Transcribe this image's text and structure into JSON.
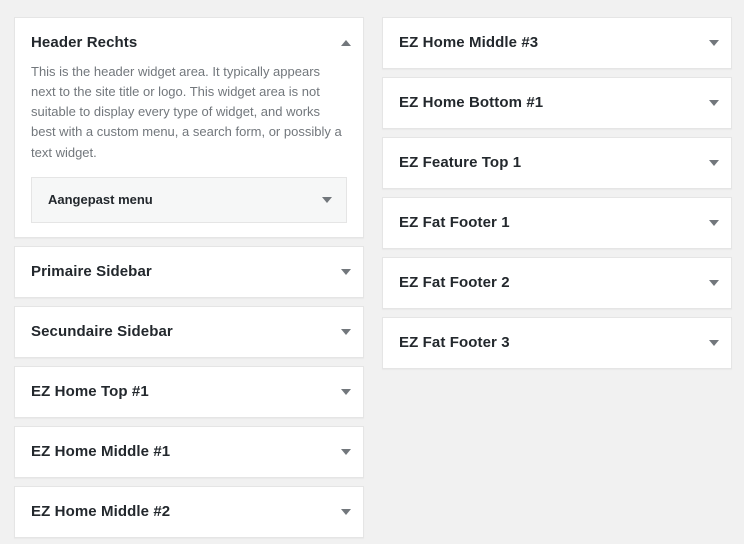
{
  "colors": {
    "page_background": "#f1f1f1",
    "panel_background": "#ffffff",
    "panel_border": "#e5e5e5",
    "title_text": "#23282d",
    "description_text": "#72777c",
    "widget_item_background": "#f6f7f7",
    "toggle_arrow": "#72777c"
  },
  "icons": {
    "collapsed": "chevron-down-icon",
    "expanded": "chevron-up-icon"
  },
  "columns": {
    "left": {
      "widget_areas": [
        {
          "title": "Header Rechts",
          "expanded": true,
          "toggle_icon": "chevron-up-icon",
          "description": "This is the header widget area. It typically appears next to the site title or logo. This widget area is not suitable to display every type of widget, and works best with a custom menu, a search form, or possibly a text widget.",
          "widgets": [
            {
              "title": "Aangepast menu",
              "toggle_icon": "chevron-down-icon"
            }
          ]
        },
        {
          "title": "Primaire Sidebar",
          "expanded": false,
          "toggle_icon": "chevron-down-icon"
        },
        {
          "title": "Secundaire Sidebar",
          "expanded": false,
          "toggle_icon": "chevron-down-icon"
        },
        {
          "title": "EZ Home Top #1",
          "expanded": false,
          "toggle_icon": "chevron-down-icon"
        },
        {
          "title": "EZ Home Middle #1",
          "expanded": false,
          "toggle_icon": "chevron-down-icon"
        },
        {
          "title": "EZ Home Middle #2",
          "expanded": false,
          "toggle_icon": "chevron-down-icon"
        }
      ]
    },
    "right": {
      "widget_areas": [
        {
          "title": "EZ Home Middle #3",
          "expanded": false,
          "toggle_icon": "chevron-down-icon"
        },
        {
          "title": "EZ Home Bottom #1",
          "expanded": false,
          "toggle_icon": "chevron-down-icon"
        },
        {
          "title": "EZ Feature Top 1",
          "expanded": false,
          "toggle_icon": "chevron-down-icon"
        },
        {
          "title": "EZ Fat Footer 1",
          "expanded": false,
          "toggle_icon": "chevron-down-icon"
        },
        {
          "title": "EZ Fat Footer 2",
          "expanded": false,
          "toggle_icon": "chevron-down-icon"
        },
        {
          "title": "EZ Fat Footer 3",
          "expanded": false,
          "toggle_icon": "chevron-down-icon"
        }
      ]
    }
  }
}
